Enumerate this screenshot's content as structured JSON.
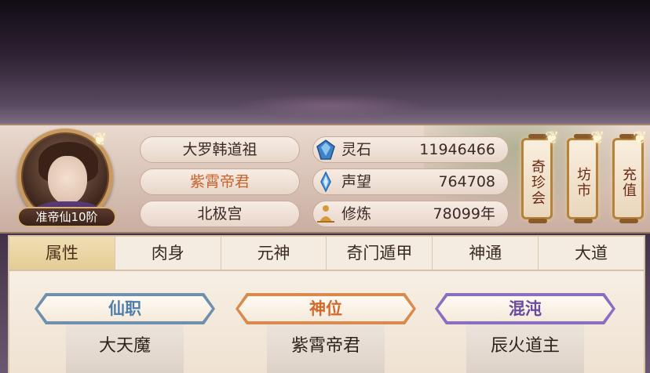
{
  "header": {
    "rank": "准帝仙10阶",
    "titles": [
      "大罗韩道祖",
      "紫霄帝君",
      "北极宫"
    ],
    "resources": [
      {
        "label": "灵石",
        "value": "11946466",
        "icon": "spirit-stone-icon",
        "color": "#3f82c8"
      },
      {
        "label": "声望",
        "value": "764708",
        "icon": "reputation-crystal-icon",
        "color": "#5aa8e6"
      },
      {
        "label": "修炼",
        "value": "78099年",
        "icon": "meditation-icon",
        "color": "#d69a3a"
      }
    ]
  },
  "side_buttons": [
    {
      "label": "奇珍会"
    },
    {
      "label": "坊市"
    },
    {
      "label": "充值"
    }
  ],
  "tabs": [
    "属性",
    "肉身",
    "元神",
    "奇门遁甲",
    "神通",
    "大道"
  ],
  "active_tab": "属性",
  "cards": [
    {
      "title": "仙职",
      "value": "大天魔",
      "color": "#4f7fa8"
    },
    {
      "title": "神位",
      "value": "紫霄帝君",
      "color": "#d2692a"
    },
    {
      "title": "混沌",
      "value": "辰火道主",
      "color": "#6a4a9e"
    }
  ]
}
